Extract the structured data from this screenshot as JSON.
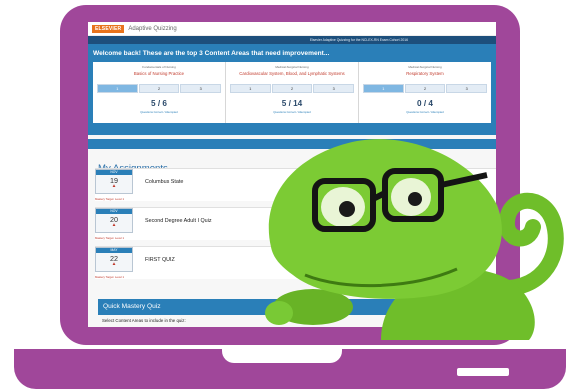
{
  "app": {
    "brand": "ELSEVIER",
    "title": "Adaptive Quizzing"
  },
  "subheader": "Elsevier Adaptive Quizzing for the NCLEX-RN Exam Cohort 2016",
  "welcome": {
    "title": "Welcome back! These are the top 3 Content Areas that need improvement...",
    "cards": [
      {
        "category": "Fundamentals of Nursing",
        "area": "Basics of Nursing Practice",
        "segments": [
          "1",
          "2",
          "3"
        ],
        "active": 0,
        "score": "5 / 6",
        "score_label": "Questions Correct / Attempted"
      },
      {
        "category": "Medical-Surgical Nursing",
        "area": "Cardiovascular System, Blood, and Lymphatic Systems",
        "segments": [
          "1",
          "2",
          "3"
        ],
        "active": -1,
        "score": "5 / 14",
        "score_label": "Questions Correct / Attempted"
      },
      {
        "category": "Medical-Surgical Nursing",
        "area": "Respiratory System",
        "segments": [
          "1",
          "2",
          "3"
        ],
        "active": 0,
        "score": "0 / 4",
        "score_label": "Questions Correct / Attempted"
      }
    ]
  },
  "assignments": {
    "heading": "My Assignments",
    "items": [
      {
        "month": "NOV",
        "day": "19",
        "name": "Columbus State",
        "meta": "Mastery Target: Level 1"
      },
      {
        "month": "NOV",
        "day": "20",
        "name": "Second Degree Adult I Quiz",
        "meta": "Mastery Target: Level 1"
      },
      {
        "month": "MAY",
        "day": "22",
        "name": "FIRST QUIZ",
        "meta": "Mastery Target: Level 1"
      }
    ]
  },
  "quick_mastery": {
    "title": "Quick Mastery Quiz",
    "prompt": "Select Content Areas to include in the quiz:"
  },
  "colors": {
    "frame": "#a0479a",
    "accent": "#2a7fb8",
    "mascot": "#6fbe2a"
  }
}
